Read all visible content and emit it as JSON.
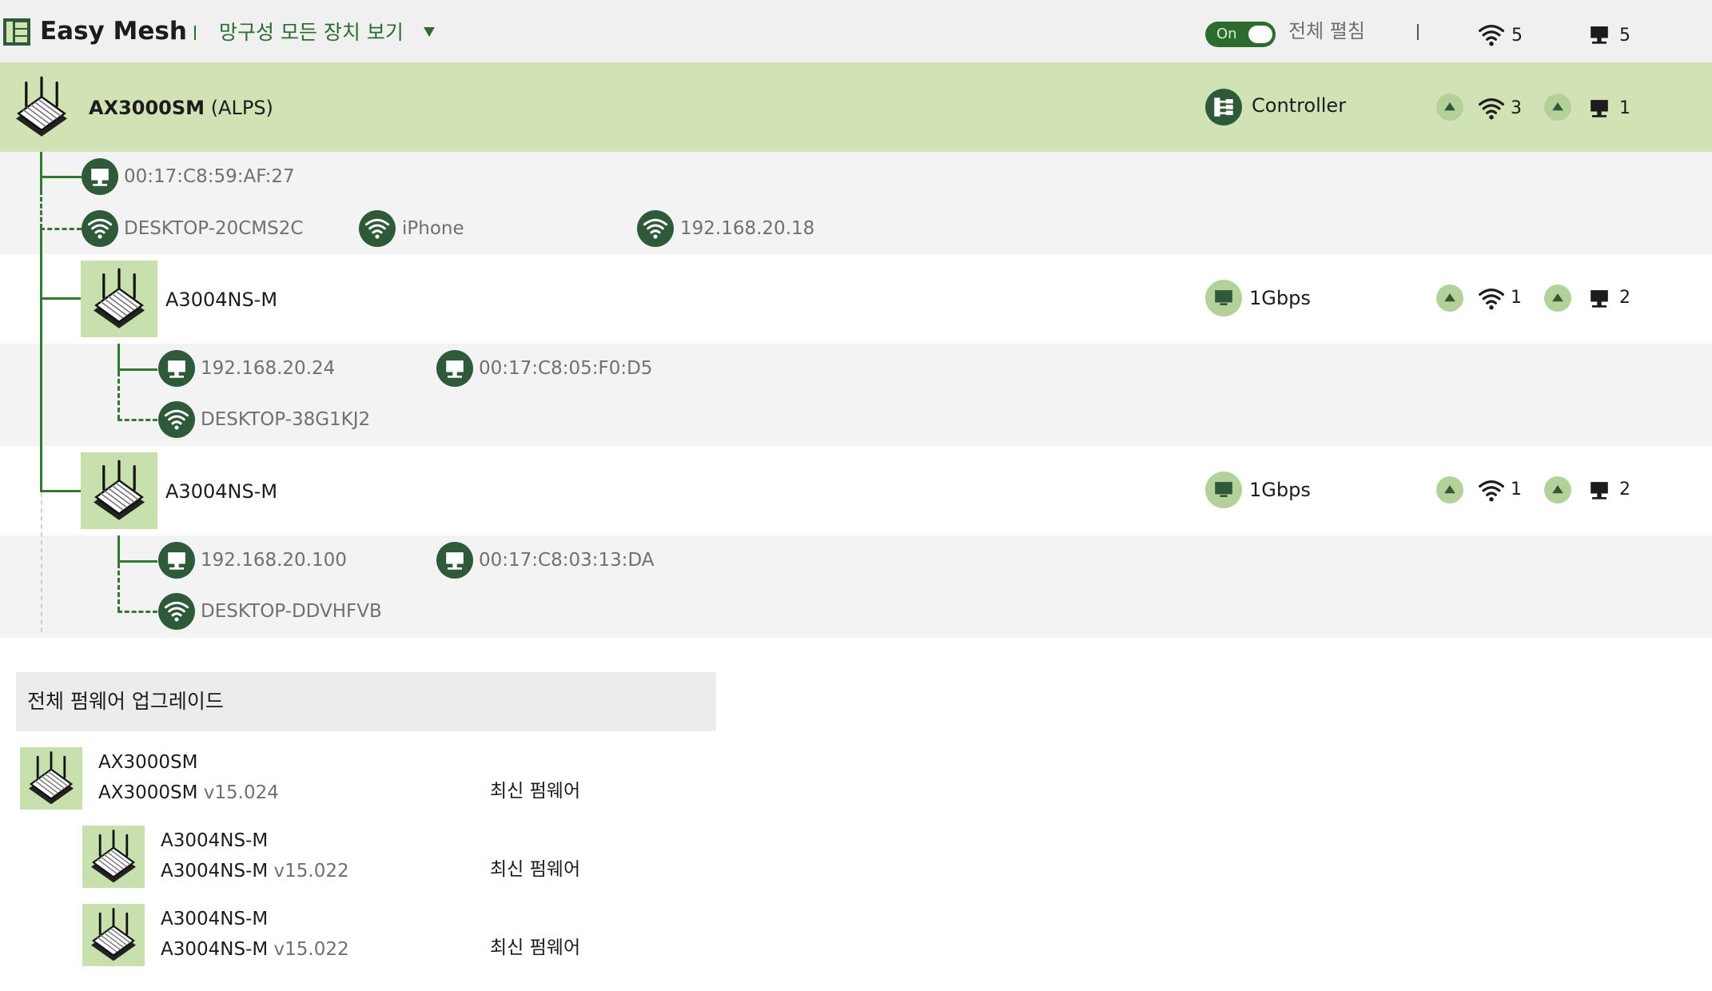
{
  "header": {
    "title": "Easy Mesh",
    "view_label": "망구성 모든 장치 보기",
    "toggle_label": "On",
    "expand_label": "전체 펼침",
    "wifi_count": "5",
    "wired_count": "5"
  },
  "controller": {
    "name": "AX3000SM",
    "location": "(ALPS)",
    "role": "Controller",
    "wifi_count": "3",
    "wired_count": "1",
    "clients_wired": [
      "00:17:C8:59:AF:27"
    ],
    "clients_wifi": [
      "DESKTOP-20CMS2C",
      "iPhone",
      "192.168.20.18"
    ]
  },
  "agents": [
    {
      "name": "A3004NS-M",
      "link": "1Gbps",
      "wifi_count": "1",
      "wired_count": "2",
      "clients_wired": [
        "192.168.20.24",
        "00:17:C8:05:F0:D5"
      ],
      "clients_wifi": [
        "DESKTOP-38G1KJ2"
      ]
    },
    {
      "name": "A3004NS-M",
      "link": "1Gbps",
      "wifi_count": "1",
      "wired_count": "2",
      "clients_wired": [
        "192.168.20.100",
        "00:17:C8:03:13:DA"
      ],
      "clients_wifi": [
        "DESKTOP-DDVHFVB"
      ]
    }
  ],
  "firmware": {
    "title": "전체 펌웨어 업그레이드",
    "items": [
      {
        "model": "AX3000SM",
        "model2": "AX3000SM",
        "version": "v15.024",
        "status": "최신 펌웨어"
      },
      {
        "model": "A3004NS-M",
        "model2": "A3004NS-M",
        "version": "v15.022",
        "status": "최신 펌웨어"
      },
      {
        "model": "A3004NS-M",
        "model2": "A3004NS-M",
        "version": "v15.022",
        "status": "최신 펌웨어"
      }
    ]
  },
  "colors": {
    "accent": "#2e6b2e",
    "controller_row": "#d1e3b5",
    "icon_dark": "#2e5a3a",
    "icon_light": "#b5d19a"
  }
}
